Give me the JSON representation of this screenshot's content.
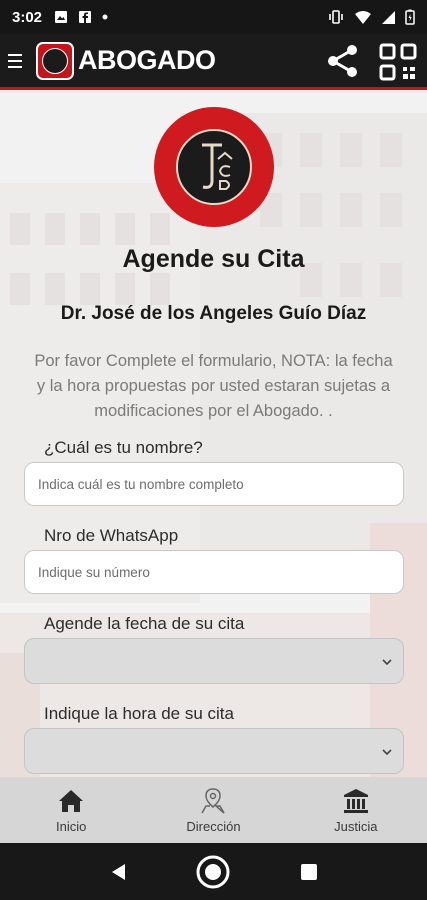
{
  "status_bar": {
    "time": "3:02"
  },
  "app_bar": {
    "title": "ABOGADO"
  },
  "page": {
    "title": "Agende su Cita",
    "lawyer_name": "Dr. José de los Angeles Guío Díaz",
    "notice": "Por favor Complete el formulario, NOTA: la fecha y la hora propuestas por usted estaran sujetas a modificaciones por el Abogado. ."
  },
  "form": {
    "name_label": "¿Cuál es tu nombre?",
    "name_placeholder": "Indica cuál es tu nombre completo",
    "whatsapp_label": "Nro de WhatsApp",
    "whatsapp_placeholder": "Indique su número",
    "date_label": "Agende la fecha de su cita",
    "time_label": "Indique la hora de su cita"
  },
  "bottom_nav": [
    {
      "label": "Inicio",
      "icon": "home-icon"
    },
    {
      "label": "Dirección",
      "icon": "map-pin-icon"
    },
    {
      "label": "Justicia",
      "icon": "courthouse-icon"
    }
  ],
  "colors": {
    "brand_red": "#c3161c",
    "app_bar": "#1b1b1b",
    "bottom_nav": "#d6d6d6"
  }
}
